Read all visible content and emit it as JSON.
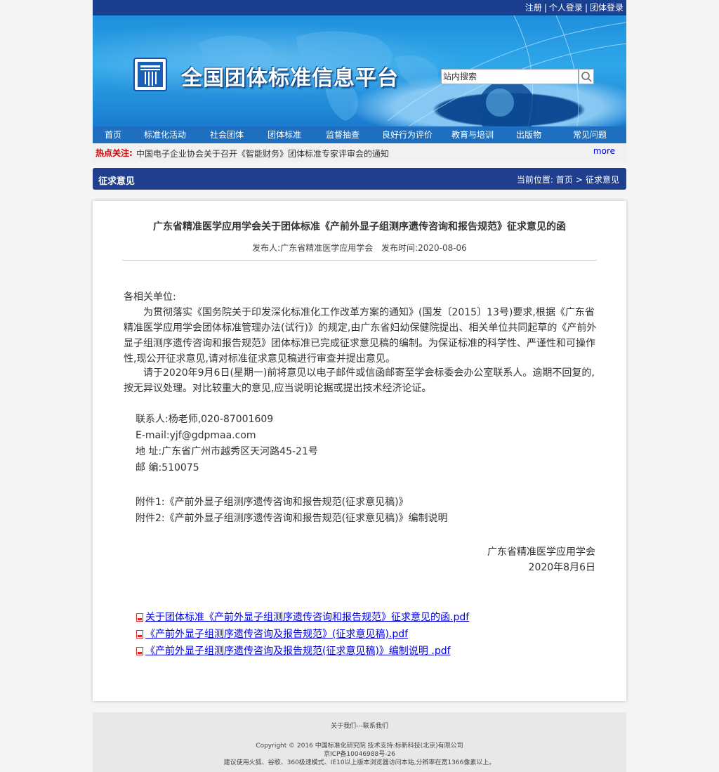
{
  "top_links": [
    "注册",
    "个人登录",
    "团体登录"
  ],
  "site": {
    "title": "全国团体标准信息平台",
    "search_placeholder": "站内搜索"
  },
  "nav": [
    "首页",
    "标准化活动",
    "社会团体",
    "团体标准",
    "监督抽查",
    "良好行为评价",
    "教育与培训",
    "出版物",
    "常见问题"
  ],
  "hot": {
    "label": "热点关注:",
    "text": "中国电子企业协会关于召开《智能财务》团体标准专家评审会的通知",
    "more": "more"
  },
  "section": {
    "title": "征求意见",
    "crumb_prefix": "当前位置:",
    "crumb_home": "首页",
    "crumb_sep": ">",
    "crumb_current": "征求意见"
  },
  "article": {
    "title": "广东省精准医学应用学会关于团体标准《产前外显子组测序遗传咨询和报告规范》征求意见的函",
    "publisher": "发布人:广东省精准医学应用学会",
    "date": "发布时间:2020-08-06",
    "salutation": "各相关单位:",
    "para1": "为贯彻落实《国务院关于印发深化标准化工作改革方案的通知》(国发〔2015〕13号)要求,根据《广东省精准医学应用学会团体标准管理办法(试行)》的规定,由广东省妇幼保健院提出、相关单位共同起草的《产前外显子组测序遗传咨询和报告规范》团体标准已完成征求意见稿的编制。为保证标准的科学性、严谨性和可操作性,现公开征求意见,请对标准征求意见稿进行审查并提出意见。",
    "para2": "请于2020年9月6日(星期一)前将意见以电子邮件或信函邮寄至学会标委会办公室联系人。逾期不回复的,按无异议处理。对比较重大的意见,应当说明论据或提出技术经济论证。",
    "contact": [
      "联系人:杨老师,020-87001609",
      "E-mail:yjf@gdpmaa.com",
      "地 址:广东省广州市越秀区天河路45-21号",
      "邮 编:510075"
    ],
    "attachments": [
      "附件1:《产前外显子组测序遗传咨询和报告规范(征求意见稿)》",
      "附件2:《产前外显子组测序遗传咨询和报告规范(征求意见稿)》编制说明"
    ],
    "sign_org": "广东省精准医学应用学会",
    "sign_date": "2020年8月6日",
    "files": [
      "关于团体标准《产前外显子组测序遗传咨询和报告规范》征求意见的函.pdf",
      "《产前外显子组测序遗传咨询及报告规范》(征求意见稿).pdf",
      "《产前外显子组测序遗传咨询及报告规范(征求意见稿)》编制说明 .pdf"
    ]
  },
  "footer": {
    "links": "关于我们---联系我们",
    "copyright": "Copyright © 2016 中国标准化研究院 技术支持:标新科技(北京)有限公司",
    "icp": "京ICP备10046988号-26",
    "browser": "建议使用火狐、谷歌、360极速模式、IE10以上版本浏览器访问本站,分辨率在宽1366像素以上。"
  },
  "colors": {
    "topbar": "#1b3f8f",
    "nav": "#1e6fc0",
    "section_header": "#1f3e8e",
    "hot_label": "#d40000",
    "link": "#0000ee"
  }
}
